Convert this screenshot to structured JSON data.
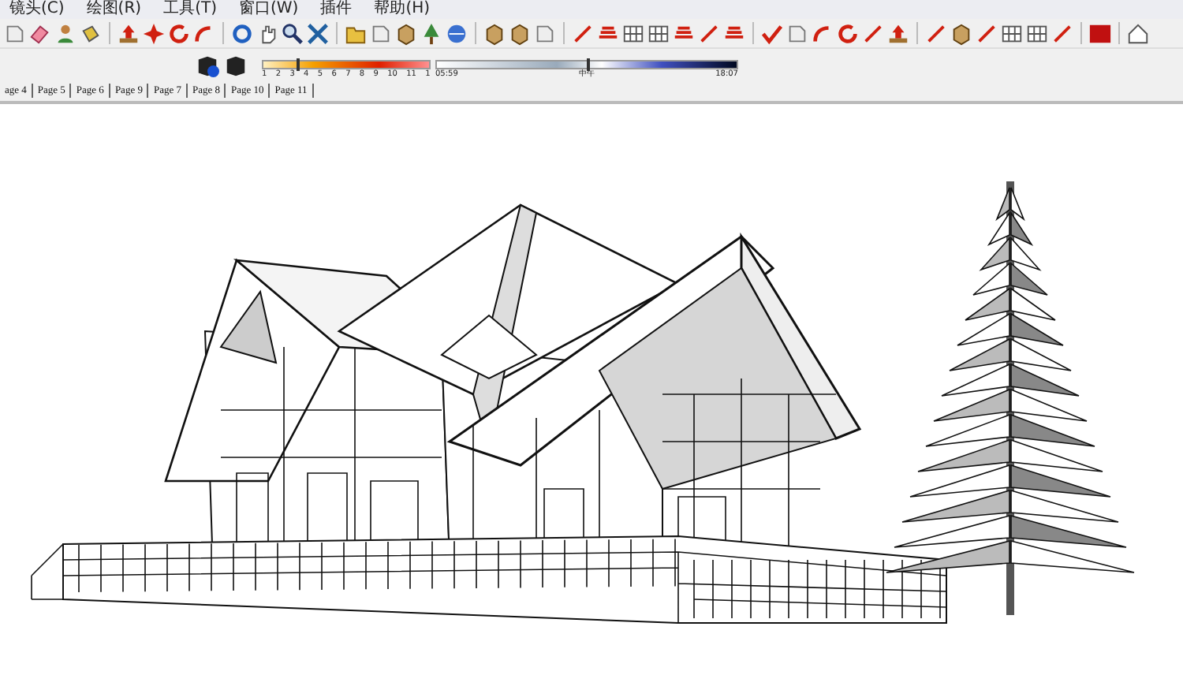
{
  "menu": [
    "镜头(C)",
    "绘图(R)",
    "工具(T)",
    "窗口(W)",
    "插件",
    "帮助(H)"
  ],
  "shadow_settings": {
    "month_slider": {
      "level": 0.2
    },
    "time_slider": {
      "level": 0.5
    },
    "month_labels": [
      "1",
      "2",
      "3",
      "4",
      "5",
      "6",
      "7",
      "8",
      "9",
      "10",
      "11",
      "1"
    ],
    "time_start": "05:59",
    "time_middle": "中午",
    "time_end": "18:07"
  },
  "scene_tabs": [
    "age 4",
    "Page 5",
    "Page 6",
    "Page 9",
    "Page 7",
    "Page 8",
    "Page 10",
    "Page 11"
  ]
}
